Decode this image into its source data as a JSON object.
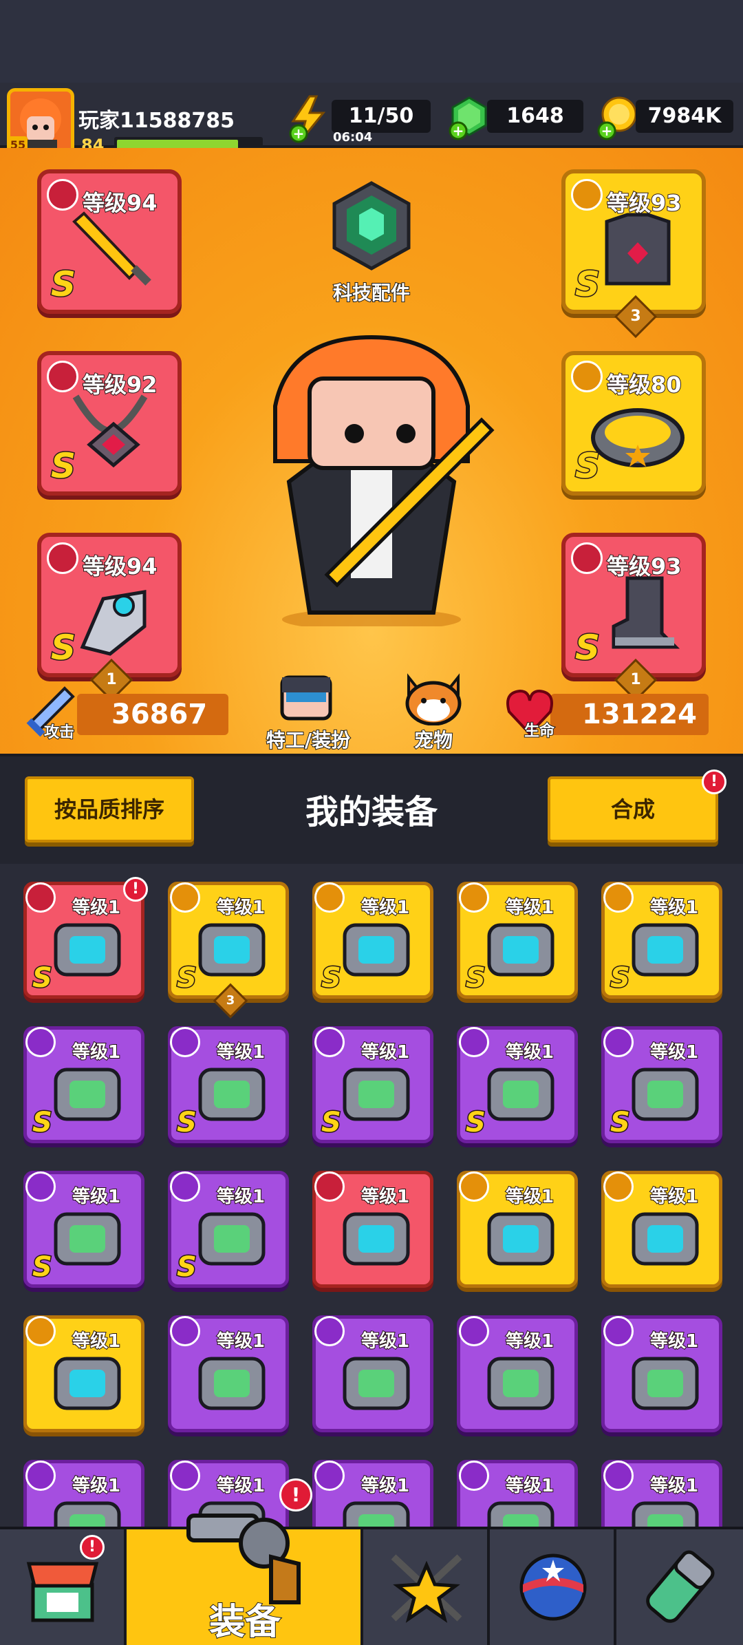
{
  "player": {
    "name": "玩家11588785",
    "level": "55",
    "xp_level": "84"
  },
  "resources": {
    "energy": "11/50",
    "energy_timer": "06:04",
    "gems": "1648",
    "coins": "7984K"
  },
  "equipped": [
    {
      "level": "等级94",
      "rank": "S",
      "type": "weapon",
      "rarity": "red"
    },
    {
      "level": "等级93",
      "rank": "S",
      "type": "armor",
      "rarity": "gold",
      "stars": "3"
    },
    {
      "level": "等级92",
      "rank": "S",
      "type": "necklace",
      "rarity": "red"
    },
    {
      "level": "等级80",
      "rank": "S",
      "type": "belt",
      "rarity": "gold"
    },
    {
      "level": "等级94",
      "rank": "S",
      "type": "glove",
      "rarity": "red",
      "stars": "1"
    },
    {
      "level": "等级93",
      "rank": "S",
      "type": "boots",
      "rarity": "red",
      "stars": "1"
    }
  ],
  "tech_parts_label": "科技配件",
  "attack": {
    "label": "攻击",
    "value": "36867"
  },
  "hp": {
    "label": "生命",
    "value": "131224"
  },
  "agent_label": "特工/装扮",
  "pet_label": "宠物",
  "section": {
    "sort_label": "按品质排序",
    "title": "我的装备",
    "merge_label": "合成",
    "merge_badge": "!"
  },
  "inventory_items": [
    {
      "level": "等级1",
      "rank": "S",
      "rarity": "red",
      "badge": "!"
    },
    {
      "level": "等级1",
      "rank": "S",
      "rarity": "gold",
      "stars": "3"
    },
    {
      "level": "等级1",
      "rank": "S",
      "rarity": "gold"
    },
    {
      "level": "等级1",
      "rank": "S",
      "rarity": "gold"
    },
    {
      "level": "等级1",
      "rank": "S",
      "rarity": "gold"
    },
    {
      "level": "等级1",
      "rank": "S",
      "rarity": "purple"
    },
    {
      "level": "等级1",
      "rank": "S",
      "rarity": "purple"
    },
    {
      "level": "等级1",
      "rank": "S",
      "rarity": "purple"
    },
    {
      "level": "等级1",
      "rank": "S",
      "rarity": "purple"
    },
    {
      "level": "等级1",
      "rank": "S",
      "rarity": "purple"
    },
    {
      "level": "等级1",
      "rank": "S",
      "rarity": "purple"
    },
    {
      "level": "等级1",
      "rank": "S",
      "rarity": "purple"
    },
    {
      "level": "等级1",
      "rank": "",
      "rarity": "red"
    },
    {
      "level": "等级1",
      "rank": "",
      "rarity": "gold"
    },
    {
      "level": "等级1",
      "rank": "",
      "rarity": "gold"
    },
    {
      "level": "等级1",
      "rank": "",
      "rarity": "gold"
    },
    {
      "level": "等级1",
      "rank": "",
      "rarity": "purple"
    },
    {
      "level": "等级1",
      "rank": "",
      "rarity": "purple"
    },
    {
      "level": "等级1",
      "rank": "",
      "rarity": "purple"
    },
    {
      "level": "等级1",
      "rank": "",
      "rarity": "purple"
    },
    {
      "level": "等级1",
      "rank": "",
      "rarity": "purple"
    },
    {
      "level": "等级1",
      "rank": "",
      "rarity": "purple"
    },
    {
      "level": "等级1",
      "rank": "",
      "rarity": "purple"
    },
    {
      "level": "等级1",
      "rank": "",
      "rarity": "purple"
    },
    {
      "level": "等级1",
      "rank": "",
      "rarity": "purple"
    }
  ],
  "nav": {
    "shop_badge": "!",
    "equip_label": "装备",
    "equip_badge": "!"
  },
  "colors": {
    "accent": "#ffc510",
    "red_rarity": "#f45669",
    "gold_rarity": "#ffd117",
    "purple_rarity": "#a54ee0",
    "bg": "#2b2e3b"
  }
}
